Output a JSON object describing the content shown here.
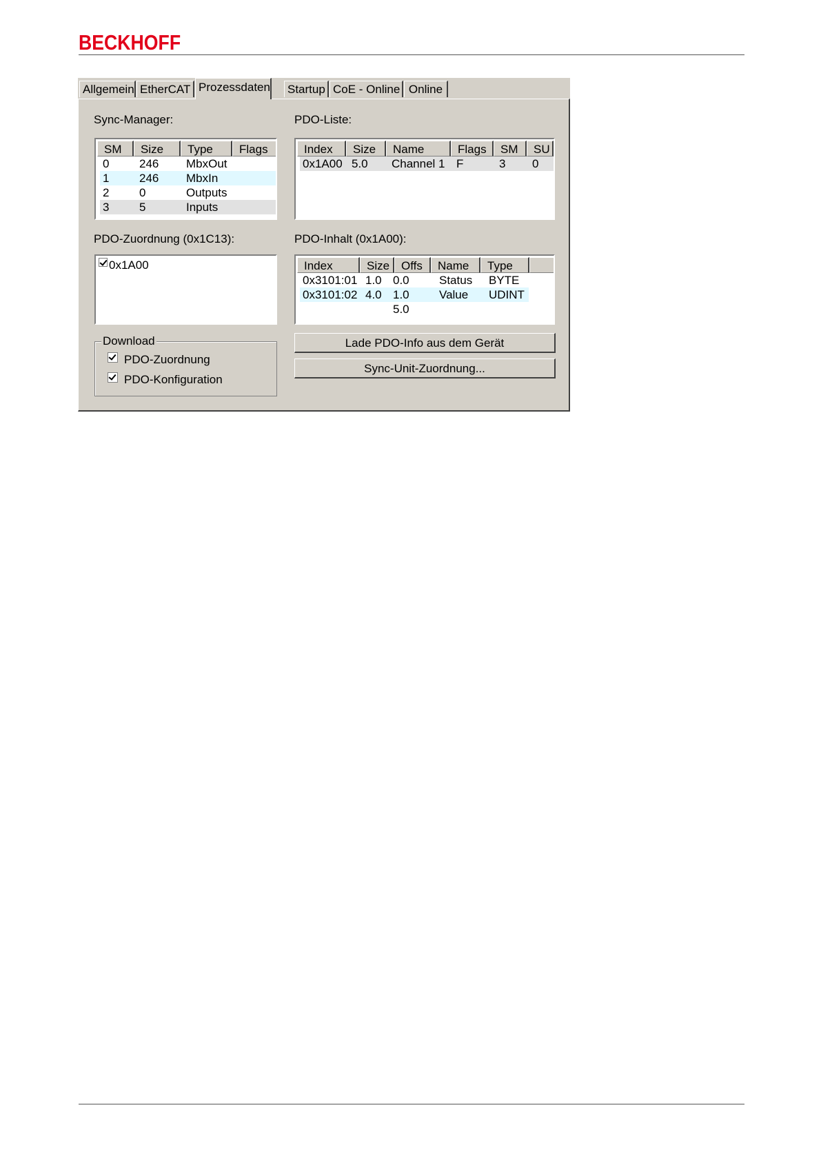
{
  "brand": {
    "logo_text": "BECKHOFF",
    "color": "#e2001a"
  },
  "dialog": {
    "tabs": [
      "Allgemein",
      "EtherCAT",
      "Prozessdaten",
      "Startup",
      "CoE - Online",
      "Online"
    ],
    "active_tab": "Prozessdaten",
    "sync_manager": {
      "label": "Sync-Manager:",
      "columns": [
        "SM",
        "Size",
        "Type",
        "Flags"
      ],
      "rows": [
        [
          "0",
          "246",
          "MbxOut",
          ""
        ],
        [
          "1",
          "246",
          "MbxIn",
          ""
        ],
        [
          "2",
          "0",
          "Outputs",
          ""
        ],
        [
          "3",
          "5",
          "Inputs",
          ""
        ]
      ]
    },
    "pdo_list": {
      "label": "PDO-Liste:",
      "columns": [
        "Index",
        "Size",
        "Name",
        "Flags",
        "SM",
        "SU"
      ],
      "rows": [
        [
          "0x1A00",
          "5.0",
          "Channel 1",
          "F",
          "3",
          "0"
        ]
      ]
    },
    "pdo_assignment": {
      "label": "PDO-Zuordnung (0x1C13):",
      "items": [
        {
          "label": "0x1A00",
          "checked": true
        }
      ]
    },
    "pdo_content": {
      "label": "PDO-Inhalt (0x1A00):",
      "columns": [
        "Index",
        "Size",
        "Offs",
        "Name",
        "Type",
        ""
      ],
      "rows": [
        [
          "0x3101:01",
          "1.0",
          "0.0",
          "Status",
          "BYTE"
        ],
        [
          "0x3101:02",
          "4.0",
          "1.0",
          "Value",
          "UDINT"
        ],
        [
          "",
          "",
          "5.0",
          "",
          ""
        ]
      ]
    },
    "download": {
      "label": "Download",
      "options": [
        {
          "label": "PDO-Zuordnung",
          "checked": true
        },
        {
          "label": "PDO-Konfiguration",
          "checked": true
        }
      ]
    },
    "buttons": {
      "load_pdo_info": "Lade PDO-Info aus dem Gerät",
      "sync_unit_assignment": "Sync-Unit-Zuordnung..."
    }
  }
}
